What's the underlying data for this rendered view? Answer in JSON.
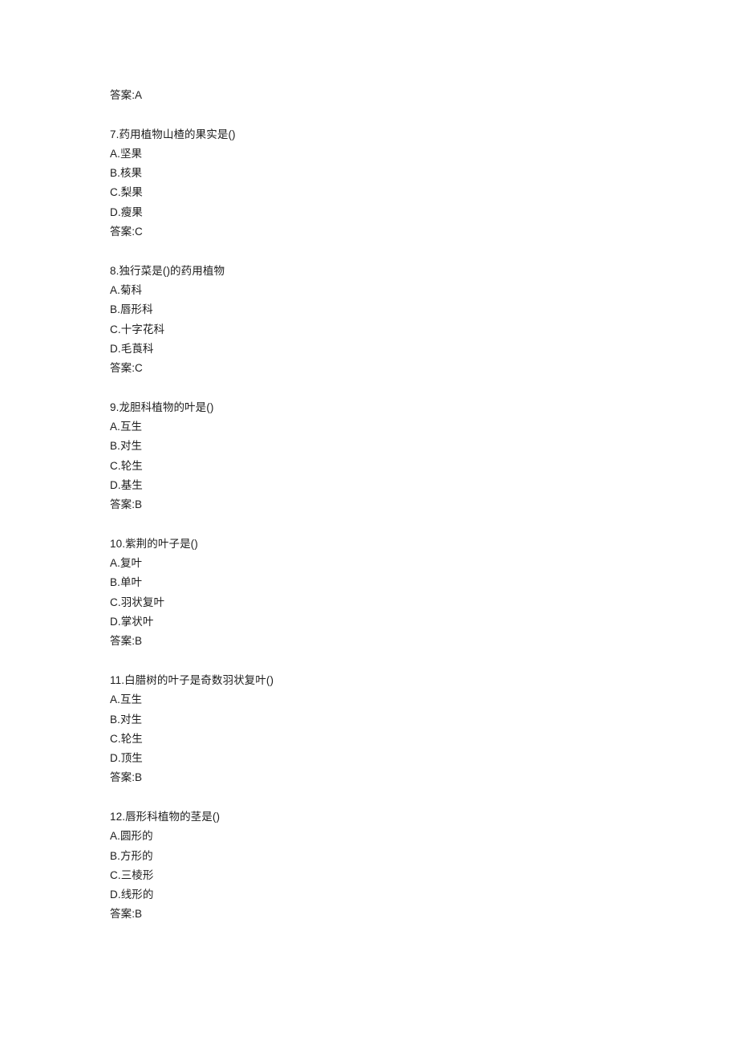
{
  "page": {
    "background_color": "#ffffff",
    "text_color": "#1d1d1d",
    "orphan_answer_line": "答案:A"
  },
  "questions": [
    {
      "stem": "7.药用植物山楂的果实是()",
      "options": [
        "A.坚果",
        "B.核果",
        "C.梨果",
        "D.瘦果"
      ],
      "answer": "答案:C"
    },
    {
      "stem": "8.独行菜是()的药用植物",
      "options": [
        "A.菊科",
        "B.唇形科",
        "C.十字花科",
        "D.毛莨科"
      ],
      "answer": "答案:C"
    },
    {
      "stem": "9.龙胆科植物的叶是()",
      "options": [
        "A.互生",
        "B.对生",
        "C.轮生",
        "D.基生"
      ],
      "answer": "答案:B"
    },
    {
      "stem": "10.紫荆的叶子是()",
      "options": [
        "A.复叶",
        "B.单叶",
        "C.羽状复叶",
        "D.掌状叶"
      ],
      "answer": "答案:B"
    },
    {
      "stem": "11.白腊树的叶子是奇数羽状复叶()",
      "options": [
        "A.互生",
        "B.对生",
        "C.轮生",
        "D.顶生"
      ],
      "answer": "答案:B"
    },
    {
      "stem": "12.唇形科植物的茎是()",
      "options": [
        "A.圆形的",
        "B.方形的",
        "C.三棱形",
        "D.线形的"
      ],
      "answer": "答案:B"
    }
  ]
}
